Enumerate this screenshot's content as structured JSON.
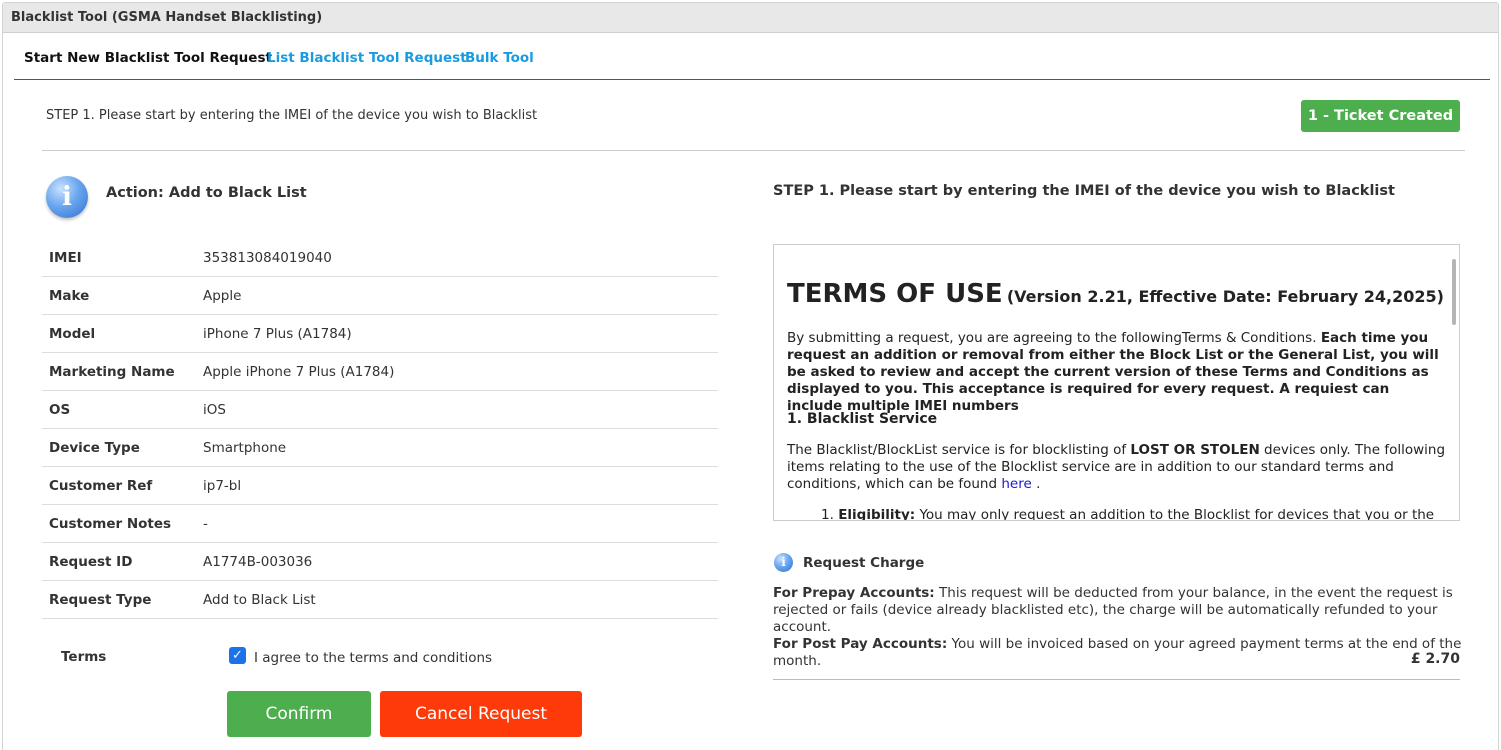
{
  "panel": {
    "title": "Blacklist Tool (GSMA Handset Blacklisting)"
  },
  "tabs": [
    {
      "label": "Start New Blacklist Tool Request",
      "active": true
    },
    {
      "label": "List Blacklist Tool Request",
      "active": false
    },
    {
      "label": "Bulk Tool",
      "active": false
    }
  ],
  "step": {
    "text": "STEP 1. Please start by entering the IMEI of the device you wish to Blacklist",
    "ticket_status": "1 - Ticket Created"
  },
  "action": {
    "title": "Action: Add to Black List",
    "icon": "info-icon"
  },
  "details": [
    {
      "label": "IMEI",
      "value": "353813084019040"
    },
    {
      "label": "Make",
      "value": "Apple"
    },
    {
      "label": "Model",
      "value": "iPhone 7 Plus (A1784)"
    },
    {
      "label": "Marketing Name",
      "value": "Apple iPhone 7 Plus (A1784)"
    },
    {
      "label": "OS",
      "value": "iOS"
    },
    {
      "label": "Device Type",
      "value": "Smartphone"
    },
    {
      "label": "Customer Ref",
      "value": "ip7-bl"
    },
    {
      "label": "Customer Notes",
      "value": "-"
    },
    {
      "label": "Request ID",
      "value": "A1774B-003036"
    },
    {
      "label": "Request Type",
      "value": "Add to Black List"
    }
  ],
  "terms": {
    "label": "Terms",
    "checked": true,
    "agree_text": "I agree to the terms and conditions"
  },
  "buttons": {
    "confirm": "Confirm",
    "cancel": "Cancel Request"
  },
  "right": {
    "step_title": "STEP 1. Please start by entering the IMEI of the device you wish to Blacklist",
    "tou": {
      "title": "TERMS OF USE",
      "version": "(Version 2.21, Effective Date: February 24,2025)",
      "p1_plain": "By submitting a request, you are agreeing to the followingTerms & Conditions. ",
      "p1_bold": "Each time you request an addition or removal from either the Block List or the General List, you will be asked to review and accept the current version of these Terms and Conditions as displayed to you. This acceptance is required for every request.  A requiest can include multiple IMEI numbers",
      "section_heading": "1. Blacklist Service",
      "p2_a": "The Blacklist/BlockList service is for blocklisting of ",
      "p2_bold": "LOST OR STOLEN",
      "p2_b": " devices only. The following items relating to the use of the Blocklist service are in addition to our standard terms and conditions, which can be found ",
      "p2_link": "here",
      "p2_c": " .",
      "li_num": "1.",
      "li_bold": "Eligibility:",
      "li_text": " You may only request an addition to the  Blocklist for devices that you or the"
    },
    "charge": {
      "title": "Request Charge",
      "prepay_label": "For Prepay Accounts:",
      "prepay_text": " This request will be deducted from your balance, in the event the request is rejected or fails (device already blacklisted etc), the charge will be automatically refunded to your account.",
      "postpay_label": "For Post Pay Accounts:",
      "postpay_text": " You will be invoiced based on your agreed payment terms at the end of the month.",
      "amount": "£ 2.70"
    }
  }
}
